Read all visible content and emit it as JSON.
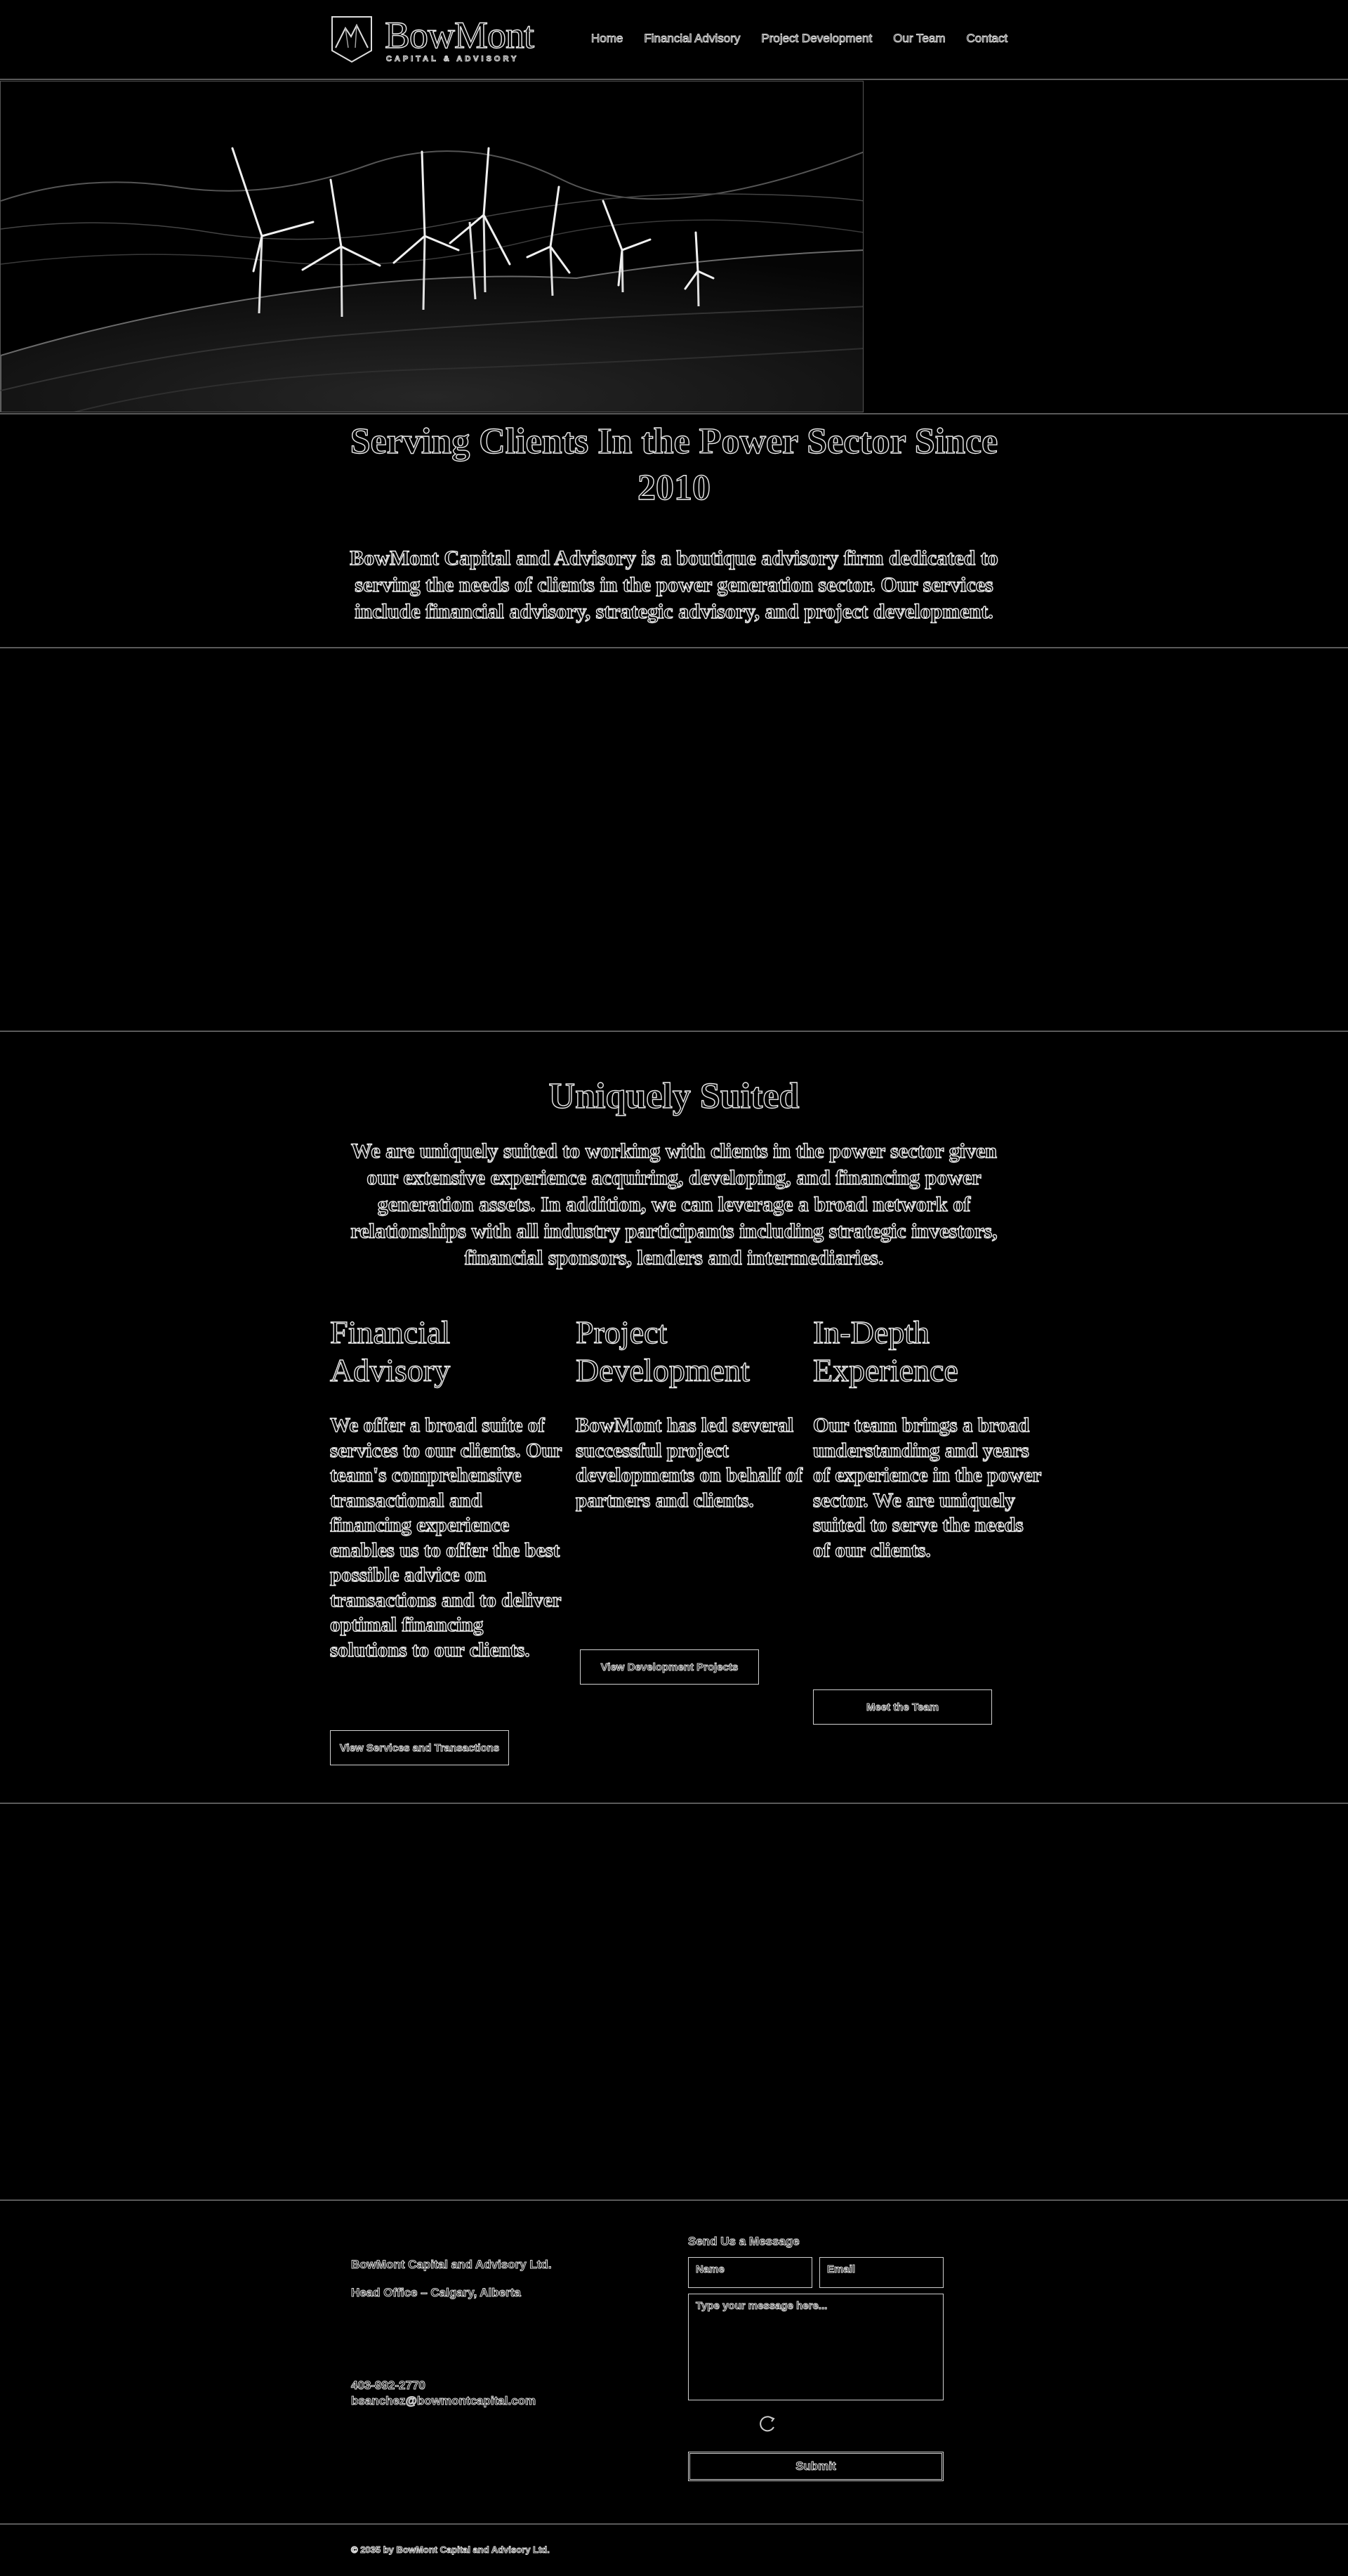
{
  "brand": {
    "name": "BowMont",
    "tagline": "CAPITAL & ADVISORY",
    "logo_icon": "mountain-shield-icon"
  },
  "nav": {
    "items": [
      {
        "label": "Home"
      },
      {
        "label": "Financial Advisory"
      },
      {
        "label": "Project Development"
      },
      {
        "label": "Our Team"
      },
      {
        "label": "Contact"
      }
    ]
  },
  "hero": {
    "image": "wind-turbines-on-hills"
  },
  "intro": {
    "title": "Serving Clients In the Power Sector Since 2010",
    "text": "BowMont Capital and Advisory is a boutique advisory firm dedicated to serving the needs of clients in the power generation sector. Our services include financial advisory, strategic advisory, and project development."
  },
  "uniquely_suited": {
    "title": "Uniquely Suited",
    "text": "We are uniquely suited to working with clients in the power sector given our extensive experience acquiring, developing, and financing power generation assets. In addition, we can leverage a broad network of relationships with all industry participants including strategic investors, financial sponsors, lenders and intermediaries.",
    "columns": [
      {
        "title": "Financial Advisory",
        "text": "We offer a broad suite of services to our clients. Our team's comprehensive transactional and financing experience enables us to offer the best possible advice on transactions and to deliver optimal financing solutions to our clients.",
        "button": "View Services and Transactions"
      },
      {
        "title": "Project Development",
        "text": "BowMont has led several successful project developments on behalf of partners and clients.",
        "button": "View Development Projects"
      },
      {
        "title": "In-Depth Experience",
        "text": "Our team brings a broad understanding and years of experience in the power sector. We are uniquely suited to serve the needs of our clients.",
        "button": "Meet the Team"
      }
    ]
  },
  "footer": {
    "company": "BowMont Capital and Advisory Ltd.",
    "office": "Head Office – Calgary, Alberta",
    "phone": "403-992-2770",
    "email": "bsanchez@bowmontcapital.com",
    "form": {
      "title": "Send Us a Message",
      "name_placeholder": "Name",
      "email_placeholder": "Email",
      "message_placeholder": "Type your message here...",
      "submit": "Submit"
    },
    "copyright": "© 2035 by BowMont Capital and Advisory Ltd."
  }
}
